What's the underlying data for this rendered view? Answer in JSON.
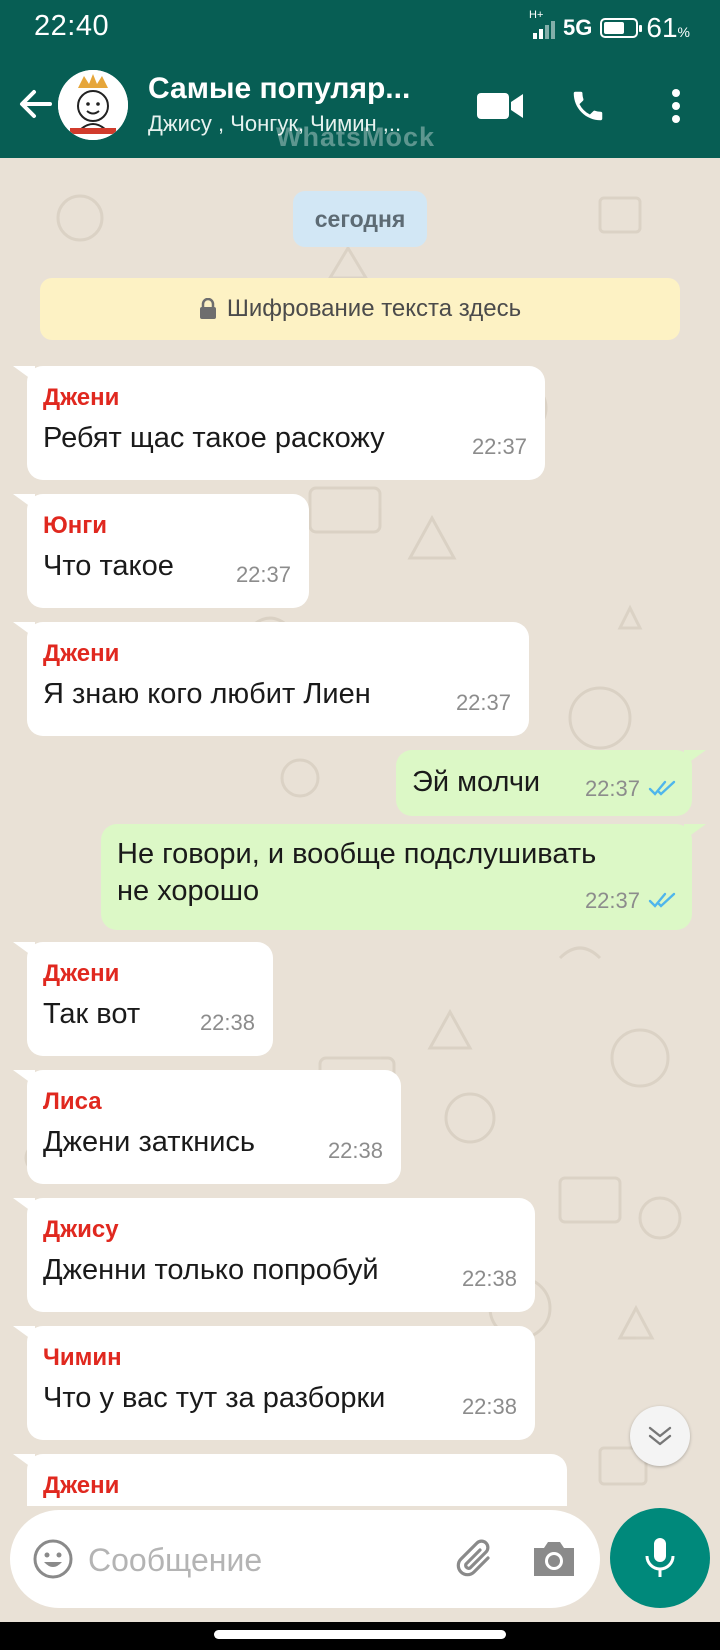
{
  "status_bar": {
    "time": "22:40",
    "network": "5G",
    "network_sub": "H+",
    "battery": "61",
    "battery_unit": "%"
  },
  "header": {
    "title": "Самые популяр...",
    "subtitle": "Джису , Чонгук, Чимин ,..",
    "watermark": "WhatsMock",
    "icons": [
      "back-arrow-icon",
      "video-call-icon",
      "phone-icon",
      "more-vert-icon"
    ]
  },
  "chat": {
    "date_chip": "сегодня",
    "encryption_notice": "Шифрование текста здесь",
    "messages": [
      {
        "direction": "in",
        "sender": "Джени",
        "text": "Ребят щас такое раскожу",
        "time": "22:37"
      },
      {
        "direction": "in",
        "sender": "Юнги",
        "text": "Что такое",
        "time": "22:37"
      },
      {
        "direction": "in",
        "sender": "Джени",
        "text": "Я знаю кого любит Лиен",
        "time": "22:37"
      },
      {
        "direction": "out",
        "text": "Эй молчи",
        "time": "22:37",
        "status": "read"
      },
      {
        "direction": "out",
        "text_line1": "Не говори, и вообще подслушивать",
        "text_line2": "не хорошо",
        "time": "22:37",
        "status": "read"
      },
      {
        "direction": "in",
        "sender": "Джени",
        "text": "Так вот",
        "time": "22:38"
      },
      {
        "direction": "in",
        "sender": "Лиса",
        "text": "Джени заткнись",
        "time": "22:38"
      },
      {
        "direction": "in",
        "sender": "Джису",
        "text": "Дженни только попробуй",
        "time": "22:38"
      },
      {
        "direction": "in",
        "sender": "Чимин",
        "text": "Что у вас тут за разборки",
        "time": "22:38"
      },
      {
        "direction": "in",
        "sender": "Джени",
        "text": "",
        "time": ""
      }
    ]
  },
  "input": {
    "placeholder": "Сообщение"
  },
  "colors": {
    "header": "#075e54",
    "chat_bg": "#e9e1d6",
    "outgoing": "#dcf8c6",
    "sender": "#e0281f",
    "read_ticks": "#4fb6ec",
    "mic": "#00897b"
  }
}
